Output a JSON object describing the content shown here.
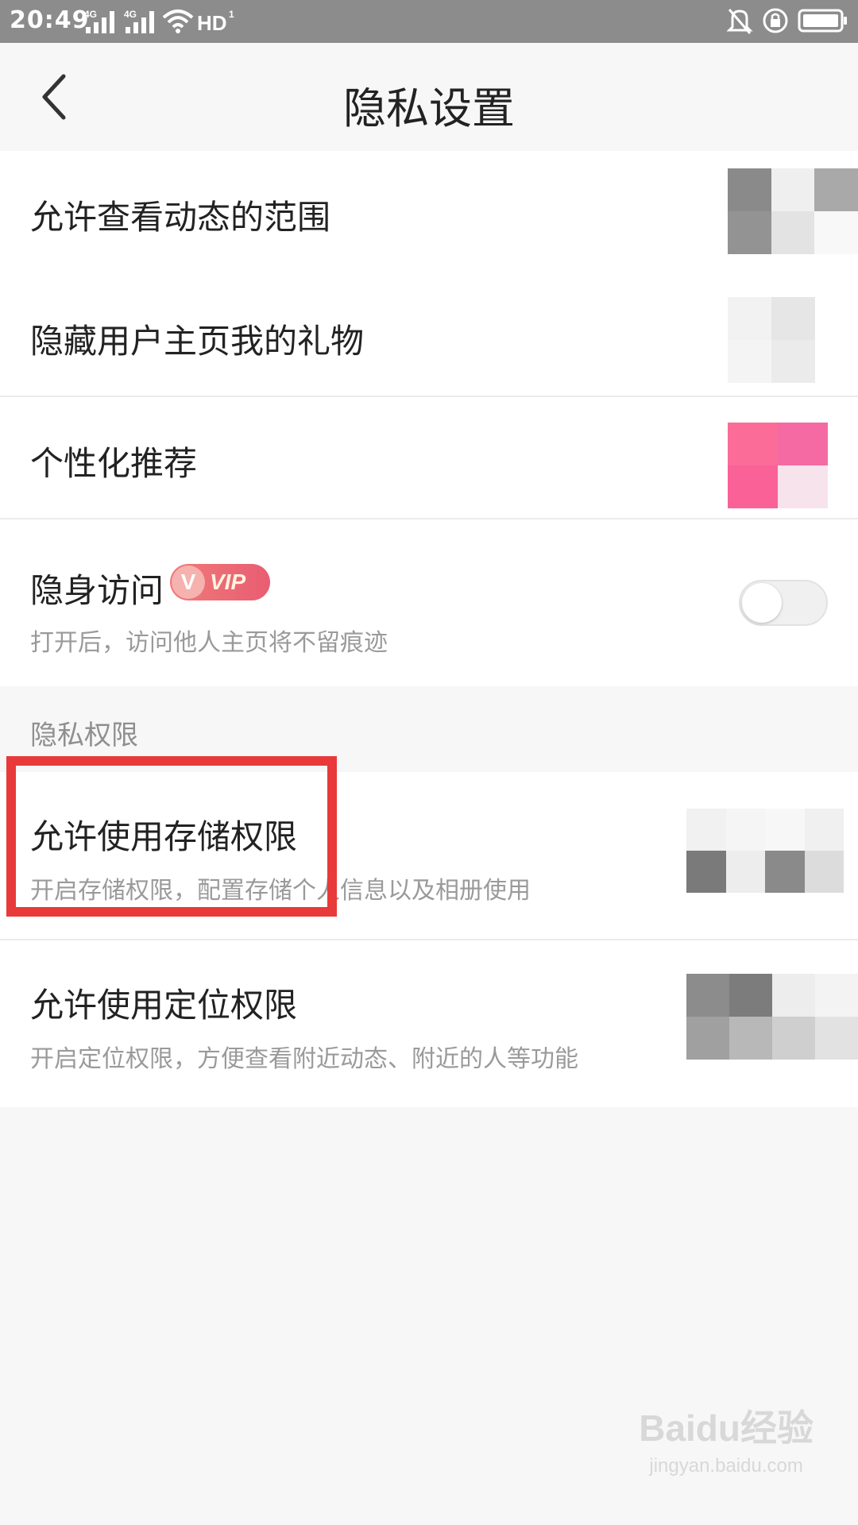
{
  "status_bar": {
    "time": "20:49",
    "signal_1_label": "4G",
    "signal_2_label": "4G",
    "hd_label": "HD",
    "hd_sub": "1 2"
  },
  "header": {
    "title": "隐私设置"
  },
  "settings": [
    {
      "title": "允许查看动态的范围"
    },
    {
      "title": "隐藏用户主页我的礼物"
    },
    {
      "title": "个性化推荐"
    },
    {
      "title": "隐身访问",
      "badge": "VIP",
      "subtitle": "打开后，访问他人主页将不留痕迹"
    }
  ],
  "section": {
    "title": "隐私权限"
  },
  "permissions": [
    {
      "title": "允许使用存储权限",
      "subtitle": "开启存储权限，配置存储个人信息以及相册使用"
    },
    {
      "title": "允许使用定位权限",
      "subtitle": "开启定位权限，方便查看附近动态、附近的人等功能"
    }
  ],
  "watermark": {
    "main": "Baidu经验",
    "sub": "jingyan.baidu.com"
  },
  "colors": {
    "status_bar": "#8c8c8c",
    "highlight": "#e83a3a",
    "vip_pink": "#e95d72",
    "recommend_pink": "#fb6c99"
  }
}
